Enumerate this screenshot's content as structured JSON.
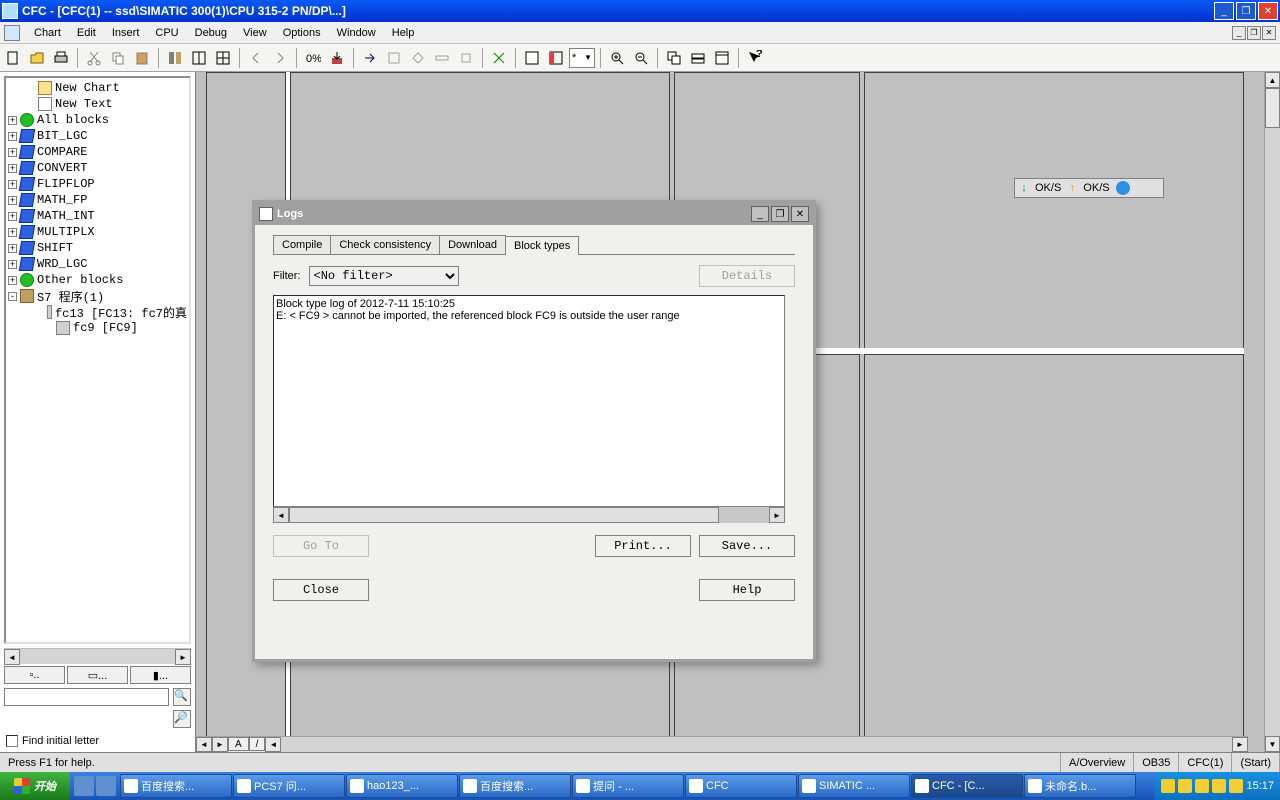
{
  "titlebar": {
    "title": "CFC - [CFC(1) -- ssd\\SIMATIC 300(1)\\CPU 315-2 PN/DP\\...]"
  },
  "menu": {
    "chart": "Chart",
    "edit": "Edit",
    "insert": "Insert",
    "cpu": "CPU",
    "debug": "Debug",
    "view": "View",
    "options": "Options",
    "window": "Window",
    "help": "Help"
  },
  "tree": {
    "items": [
      {
        "exp": "",
        "ico": "ico-chart",
        "label": "New Chart",
        "ind": 1
      },
      {
        "exp": "",
        "ico": "ico-text",
        "label": "New Text",
        "ind": 1
      },
      {
        "exp": "+",
        "ico": "ico-green",
        "label": "All blocks",
        "ind": 0
      },
      {
        "exp": "+",
        "ico": "ico-blue",
        "label": "BIT_LGC",
        "ind": 0
      },
      {
        "exp": "+",
        "ico": "ico-blue",
        "label": "COMPARE",
        "ind": 0
      },
      {
        "exp": "+",
        "ico": "ico-blue",
        "label": "CONVERT",
        "ind": 0
      },
      {
        "exp": "+",
        "ico": "ico-blue",
        "label": "FLIPFLOP",
        "ind": 0
      },
      {
        "exp": "+",
        "ico": "ico-blue",
        "label": "MATH_FP",
        "ind": 0
      },
      {
        "exp": "+",
        "ico": "ico-blue",
        "label": "MATH_INT",
        "ind": 0
      },
      {
        "exp": "+",
        "ico": "ico-blue",
        "label": "MULTIPLX",
        "ind": 0
      },
      {
        "exp": "+",
        "ico": "ico-blue",
        "label": "SHIFT",
        "ind": 0
      },
      {
        "exp": "+",
        "ico": "ico-blue",
        "label": "WRD_LGC",
        "ind": 0
      },
      {
        "exp": "+",
        "ico": "ico-green",
        "label": "Other blocks",
        "ind": 0
      },
      {
        "exp": "-",
        "ico": "ico-book",
        "label": "S7 程序(1)",
        "ind": 0
      },
      {
        "exp": "",
        "ico": "ico-fc",
        "label": "fc13  [FC13: fc7的真",
        "ind": 2
      },
      {
        "exp": "",
        "ico": "ico-fc",
        "label": "fc9  [FC9]",
        "ind": 2
      }
    ]
  },
  "find_label": "Find initial letter",
  "status_oks": {
    "a": "OK/S",
    "b": "OK/S"
  },
  "dialog": {
    "title": "Logs",
    "tabs": {
      "compile": "Compile",
      "check": "Check consistency",
      "download": "Download",
      "blocktypes": "Block types"
    },
    "filter_label": "Filter:",
    "filter_value": "<No filter>",
    "details": "Details",
    "log_line1": "Block type log of 2012-7-11 15:10:25",
    "log_line2": "E:   < FC9 > cannot be imported, the referenced block FC9 is outside the user range",
    "goto": "Go To",
    "print": "Print...",
    "save": "Save...",
    "close": "Close",
    "help": "Help"
  },
  "statusbar": {
    "help": "Press F1 for help.",
    "view": "A/Overview",
    "ob": "OB35",
    "cfc": "CFC(1)",
    "start": "(Start)"
  },
  "canvas_tab": "A",
  "taskbar": {
    "start": "开始",
    "items": [
      "百度搜索...",
      "PCS7 问...",
      "hao123_...",
      "百度搜索...",
      "提问 - ...",
      "CFC",
      "SIMATIC ...",
      "CFC - [C...",
      "未命名.b..."
    ],
    "clock": "15:17"
  }
}
